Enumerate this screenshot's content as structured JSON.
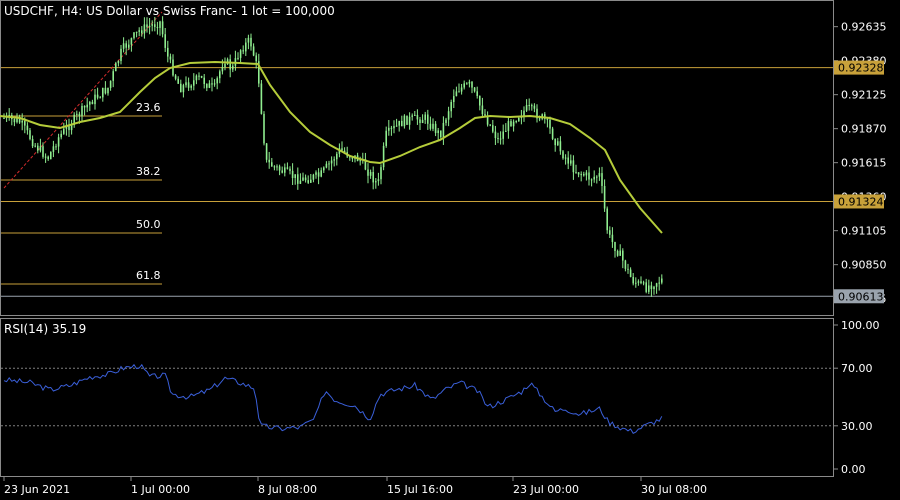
{
  "window": {
    "title": "USDCHF, H4:  US Dollar vs Swiss Franc- 1 lot = 100,000"
  },
  "colors": {
    "background": "#000000",
    "candle": "#90ee90",
    "moving_average": "#b5cc3a",
    "fib_line": "#c8a13a",
    "trend_line": "#d22b2b",
    "rsi_line": "#3a5fd9",
    "gridline": "#7f7f7f",
    "last_price_badge": "#9aa3ad"
  },
  "chart_data": [
    {
      "type": "candlestick",
      "ylim": [
        0.9048,
        0.9282
      ],
      "ytick_labels": [
        "0.92635",
        "0.92380",
        "0.92125",
        "0.91870",
        "0.91615",
        "0.91360",
        "0.91105",
        "0.90850",
        "0.90595"
      ],
      "xtick_labels": [
        "23 Jun 2021",
        "1 Jul 00:00",
        "8 Jul 08:00",
        "15 Jul 16:00",
        "23 Jul 00:00",
        "30 Jul 08:00"
      ],
      "price_badges": [
        {
          "label": "0.92328",
          "kind": "level"
        },
        {
          "label": "0.91324",
          "kind": "level"
        },
        {
          "label": "0.90613",
          "kind": "last"
        }
      ],
      "fibonacci_levels": [
        {
          "label": "23.6"
        },
        {
          "label": "38.2"
        },
        {
          "label": "50.0"
        },
        {
          "label": "61.8"
        }
      ],
      "indicator": "moving average"
    },
    {
      "type": "line",
      "title": "RSI(14) 35.19",
      "ylim": [
        0,
        100
      ],
      "ytick_labels": [
        "100.00",
        "70.00",
        "30.00",
        "0.00"
      ],
      "levels": [
        70,
        30
      ],
      "current_value": 35.19
    }
  ]
}
